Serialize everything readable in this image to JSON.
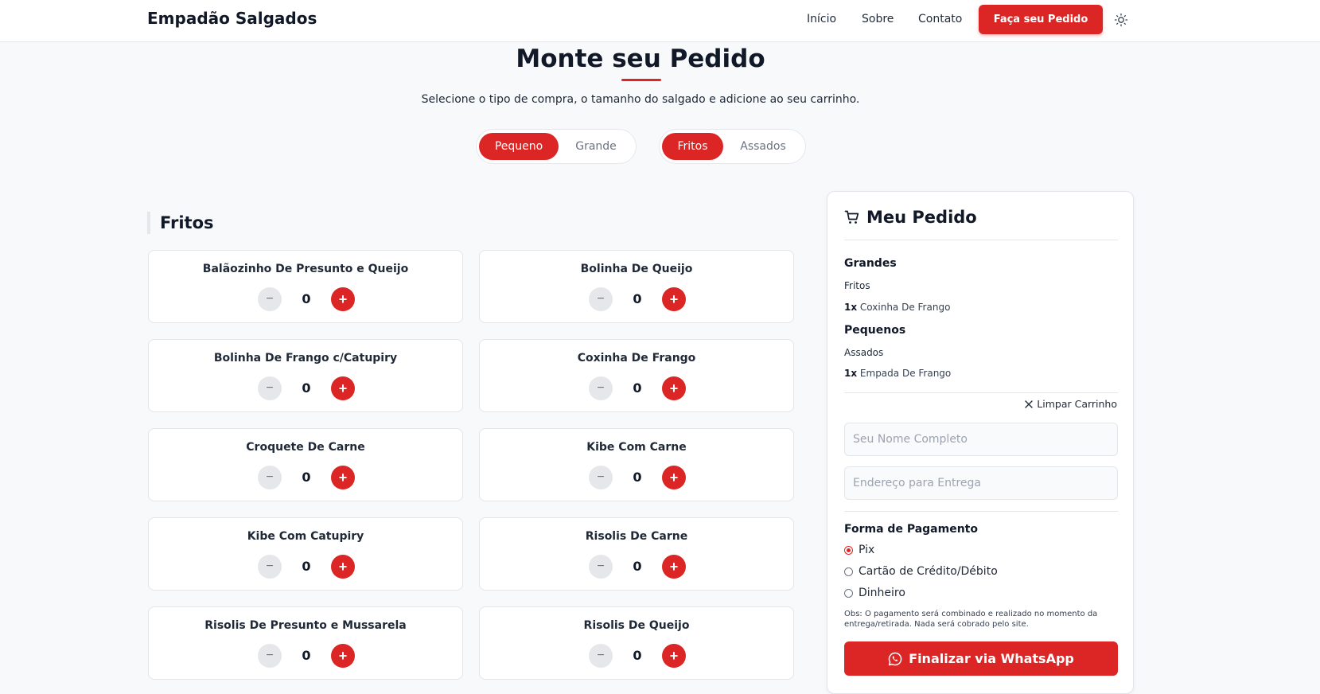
{
  "header": {
    "brand": "Empadão Salgados",
    "nav": [
      "Início",
      "Sobre",
      "Contato"
    ],
    "cta": "Faça seu Pedido",
    "theme_icon": "sun-icon"
  },
  "main": {
    "title": "Monte seu Pedido",
    "subtitle": "Selecione o tipo de compra, o tamanho do salgado e adicione ao seu carrinho.",
    "size_toggle": {
      "options": [
        "Pequeno",
        "Grande"
      ],
      "selected": "Pequeno"
    },
    "type_toggle": {
      "options": [
        "Fritos",
        "Assados"
      ],
      "selected": "Fritos"
    },
    "section_title": "Fritos",
    "products": [
      {
        "name": "Balãozinho De Presunto e Queijo",
        "qty": "0"
      },
      {
        "name": "Bolinha De Queijo",
        "qty": "0"
      },
      {
        "name": "Bolinha De Frango c/Catupiry",
        "qty": "0"
      },
      {
        "name": "Coxinha De Frango",
        "qty": "0"
      },
      {
        "name": "Croquete De Carne",
        "qty": "0"
      },
      {
        "name": "Kibe Com Carne",
        "qty": "0"
      },
      {
        "name": "Kibe Com Catupiry",
        "qty": "0"
      },
      {
        "name": "Risolis De Carne",
        "qty": "0"
      },
      {
        "name": "Risolis De Presunto e Mussarela",
        "qty": "0"
      },
      {
        "name": "Risolis De Queijo",
        "qty": "0"
      }
    ],
    "minus_symbol": "−",
    "plus_symbol": "+"
  },
  "order": {
    "title": "Meu Pedido",
    "cart_icon": "cart-icon",
    "groups": [
      {
        "size": "Grandes",
        "type": "Fritos",
        "items": [
          {
            "qty": "1x",
            "name": "Coxinha De Frango"
          }
        ]
      },
      {
        "size": "Pequenos",
        "type": "Assados",
        "items": [
          {
            "qty": "1x",
            "name": "Empada De Frango"
          }
        ]
      }
    ],
    "clear_label": "Limpar Carrinho",
    "name_placeholder": "Seu Nome Completo",
    "address_placeholder": "Endereço para Entrega",
    "payment_label": "Forma de Pagamento",
    "payment_options": [
      "Pix",
      "Cartão de Crédito/Débito",
      "Dinheiro"
    ],
    "payment_selected": "Pix",
    "obs": "Obs: O pagamento será combinado e realizado no momento da entrega/retirada. Nada será cobrado pelo site.",
    "submit_label": "Finalizar via WhatsApp",
    "submit_icon": "whatsapp-icon"
  },
  "colors": {
    "accent": "#dc2626",
    "background": "#f7f9fb",
    "text": "#111827"
  }
}
